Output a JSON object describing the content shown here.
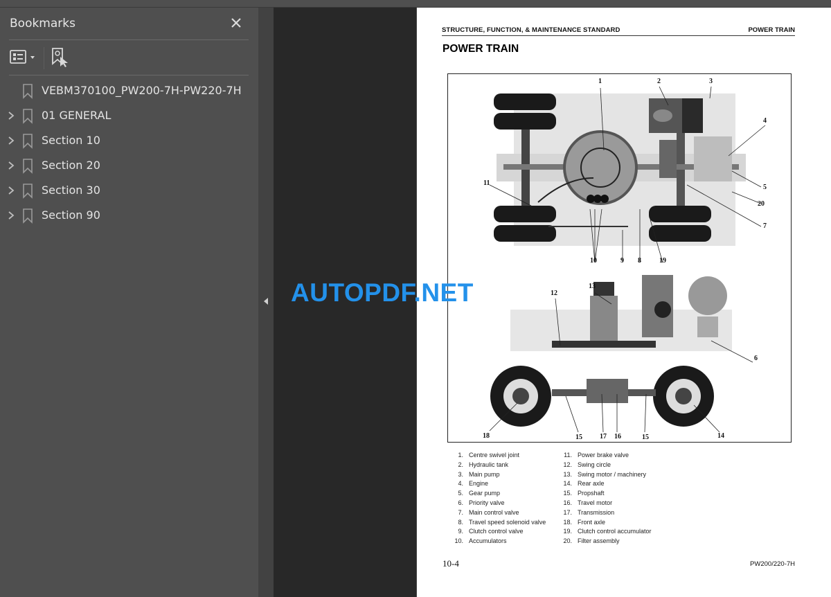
{
  "sidebar": {
    "title": "Bookmarks",
    "close_icon": "close-icon",
    "toolbar": {
      "options_icon": "bookmark-options-icon",
      "find_icon": "find-current-bookmark-icon"
    },
    "items": [
      {
        "label": "VEBM370100_PW200-7H-PW220-7H",
        "expandable": false
      },
      {
        "label": "01 GENERAL",
        "expandable": true
      },
      {
        "label": "Section 10",
        "expandable": true
      },
      {
        "label": "Section 20",
        "expandable": true
      },
      {
        "label": "Section 30",
        "expandable": true
      },
      {
        "label": "Section 90",
        "expandable": true
      }
    ]
  },
  "page": {
    "header_left": "STRUCTURE, FUNCTION, & MAINTENANCE STANDARD",
    "header_right": "POWER TRAIN",
    "title": "POWER TRAIN",
    "figure_callouts": {
      "top": [
        "1",
        "2",
        "3",
        "4",
        "5",
        "20",
        "7",
        "11",
        "10",
        "9",
        "8",
        "19"
      ],
      "bottom": [
        "12",
        "13",
        "6",
        "18",
        "15",
        "17",
        "16",
        "15",
        "14"
      ]
    },
    "legend_left": [
      {
        "num": "1.",
        "text": "Centre swivel joint"
      },
      {
        "num": "2.",
        "text": "Hydraulic tank"
      },
      {
        "num": "3.",
        "text": "Main pump"
      },
      {
        "num": "4.",
        "text": "Engine"
      },
      {
        "num": "5.",
        "text": "Gear pump"
      },
      {
        "num": "6.",
        "text": "Priority valve"
      },
      {
        "num": "7.",
        "text": "Main control valve"
      },
      {
        "num": "8.",
        "text": "Travel speed solenoid valve"
      },
      {
        "num": "9.",
        "text": "Clutch control valve"
      },
      {
        "num": "10.",
        "text": "Accumulators"
      }
    ],
    "legend_right": [
      {
        "num": "11.",
        "text": "Power brake valve"
      },
      {
        "num": "12.",
        "text": "Swing circle"
      },
      {
        "num": "13.",
        "text": "Swing motor / machinery"
      },
      {
        "num": "14.",
        "text": "Rear axle"
      },
      {
        "num": "15.",
        "text": "Propshaft"
      },
      {
        "num": "16.",
        "text": "Travel motor"
      },
      {
        "num": "17.",
        "text": "Transmission"
      },
      {
        "num": "18.",
        "text": "Front axle"
      },
      {
        "num": "19.",
        "text": "Clutch control accumulator"
      },
      {
        "num": "20.",
        "text": "Filter assembly"
      }
    ],
    "footer_left": "10-4",
    "footer_right": "PW200/220-7H"
  },
  "watermark": "AUTOPDF.NET",
  "colors": {
    "panel": "#4f4f4f",
    "viewport": "#282828",
    "watermark": "#2391ea"
  }
}
